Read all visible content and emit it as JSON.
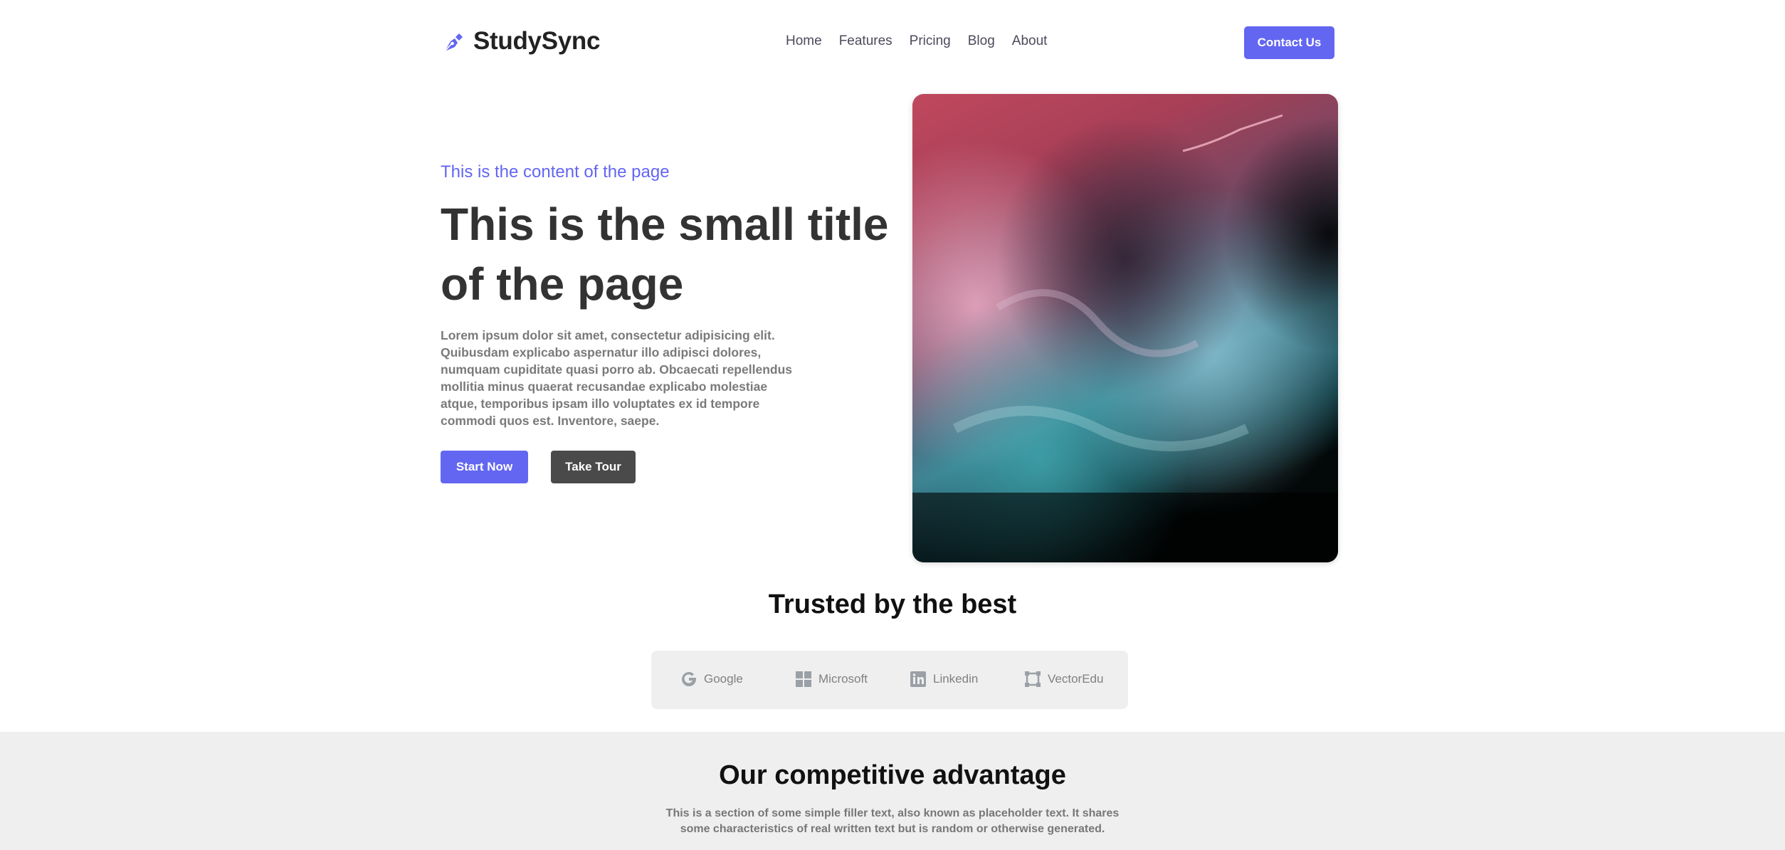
{
  "brand": {
    "name": "StudySync",
    "icon": "pen-nib-icon",
    "accent": "#6366f1"
  },
  "nav": {
    "items": [
      "Home",
      "Features",
      "Pricing",
      "Blog",
      "About"
    ]
  },
  "header": {
    "contact_label": "Contact Us"
  },
  "hero": {
    "subtitle": "This is the content of the page",
    "title": "This is the small title of the page",
    "body": "Lorem ipsum dolor sit amet, consectetur adipisicing elit. Quibusdam explicabo aspernatur illo adipisci dolores, numquam cupiditate quasi porro ab. Obcaecati repellendus mollitia minus quaerat recusandae explicabo molestiae atque, temporibus ipsam illo voluptates ex id tempore commodi quos est. Inventore, saepe.",
    "start_label": "Start Now",
    "tour_label": "Take Tour",
    "image": "abstract-ink-image"
  },
  "trusted": {
    "title": "Trusted by the best",
    "logos": [
      {
        "name": "Google",
        "icon": "google-icon"
      },
      {
        "name": "Microsoft",
        "icon": "microsoft-icon"
      },
      {
        "name": "Linkedin",
        "icon": "linkedin-icon"
      },
      {
        "name": "VectorEdu",
        "icon": "vector-square-icon"
      }
    ]
  },
  "advantage": {
    "title": "Our competitive advantage",
    "text": "This is a section of some simple filler text, also known as placeholder text. It shares some characteristics of real written text but is random or otherwise generated."
  },
  "colors": {
    "primary": "#6366f1",
    "dark_button": "#4a4a4a",
    "section_bg": "#efefef"
  }
}
